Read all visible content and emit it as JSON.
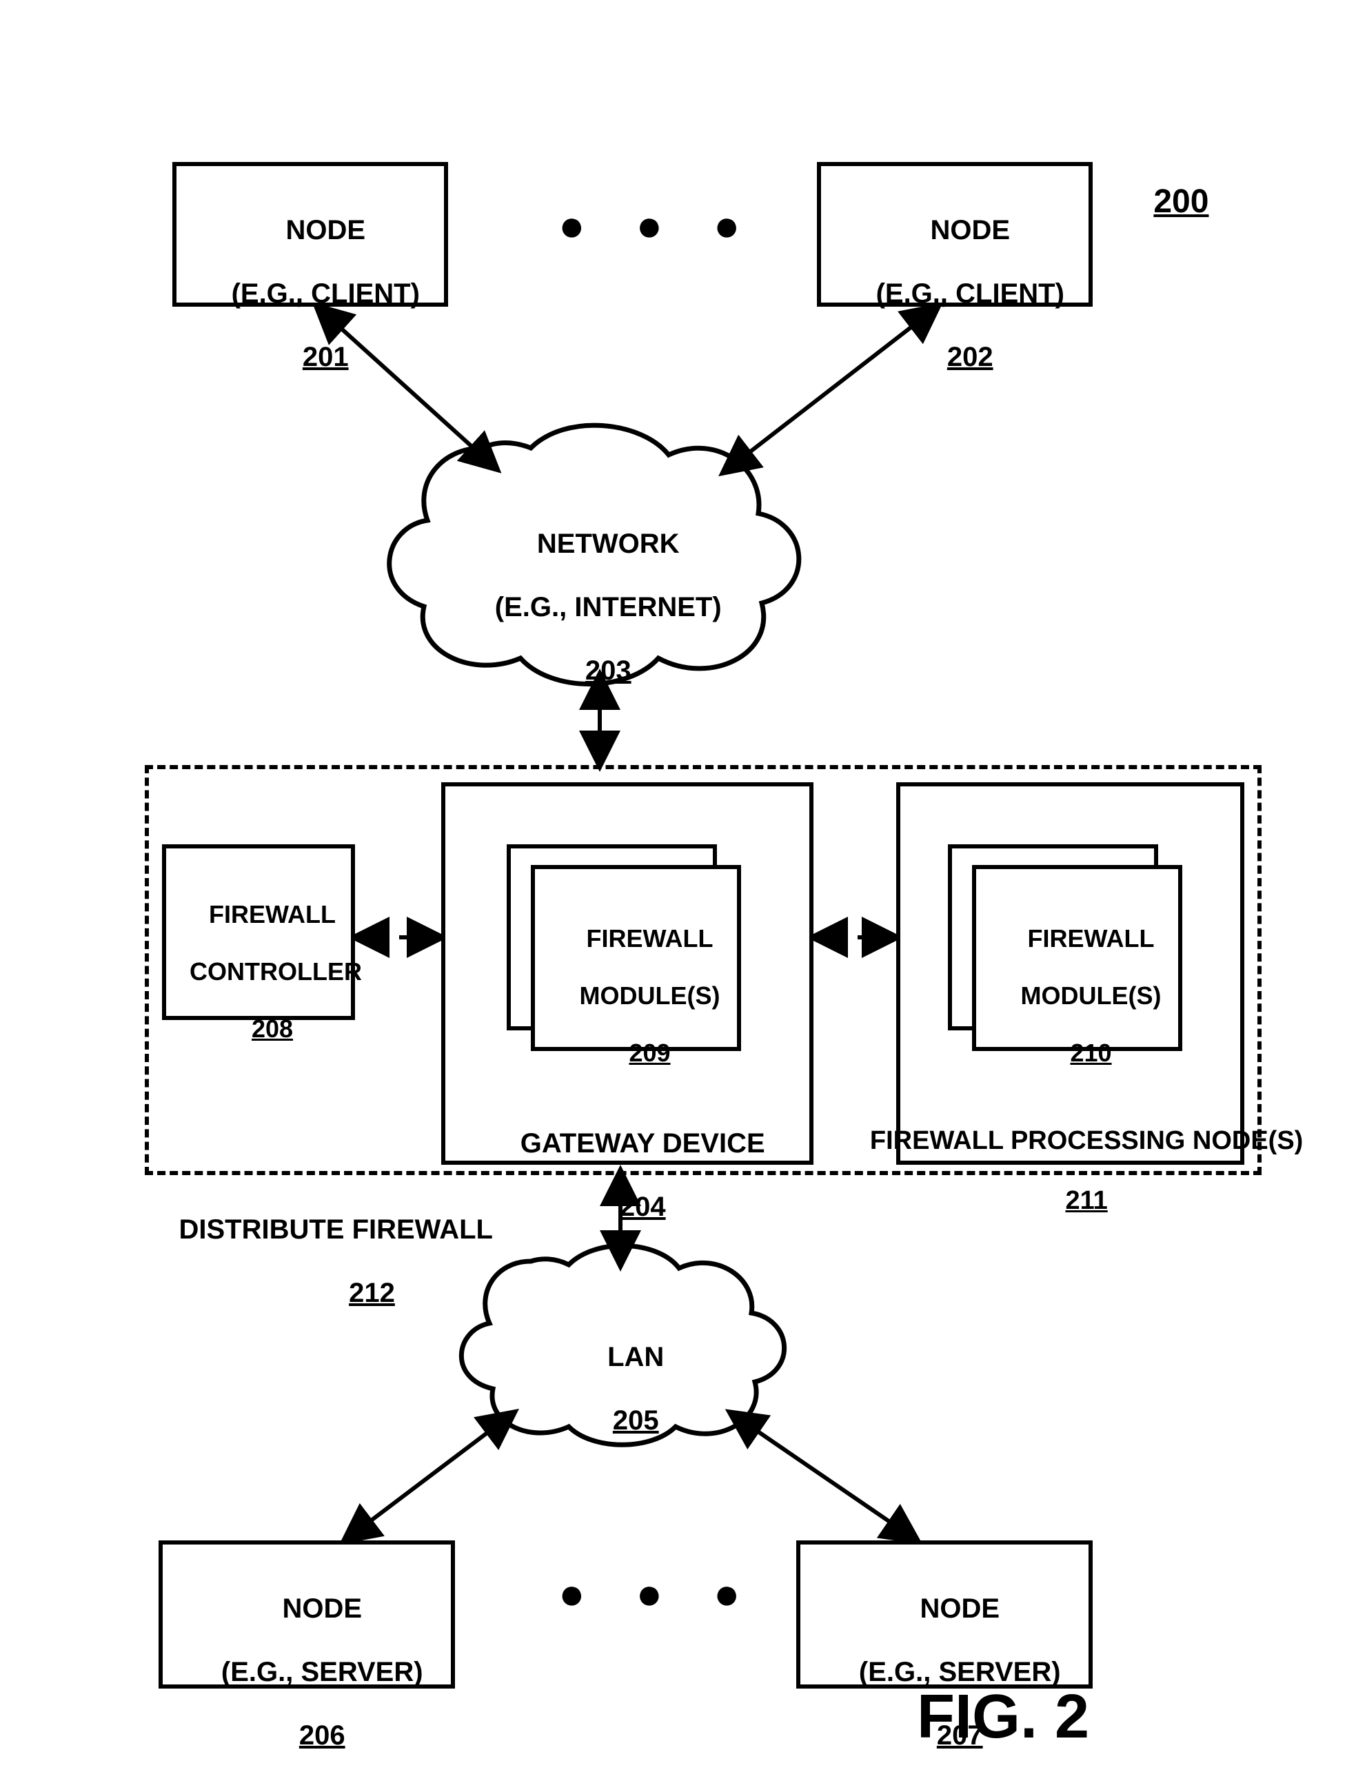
{
  "figure_id": "200",
  "figure_label": "FIG. 2",
  "nodes": {
    "client1": {
      "title": "NODE",
      "subtitle": "(E.G., CLIENT)",
      "ref": "201"
    },
    "client2": {
      "title": "NODE",
      "subtitle": "(E.G., CLIENT)",
      "ref": "202"
    },
    "network": {
      "title": "NETWORK",
      "subtitle": "(E.G., INTERNET)",
      "ref": "203"
    },
    "gateway": {
      "title": "GATEWAY DEVICE",
      "ref": "204"
    },
    "lan": {
      "title": "LAN",
      "ref": "205"
    },
    "server1": {
      "title": "NODE",
      "subtitle": "(E.G., SERVER)",
      "ref": "206"
    },
    "server2": {
      "title": "NODE",
      "subtitle": "(E.G., SERVER)",
      "ref": "207"
    },
    "fw_controller": {
      "title": "FIREWALL",
      "subtitle": "CONTROLLER",
      "ref": "208"
    },
    "fw_module_gw": {
      "title": "FIREWALL",
      "subtitle": "MODULE(S)",
      "ref": "209"
    },
    "fw_module_pn": {
      "title": "FIREWALL",
      "subtitle": "MODULE(S)",
      "ref": "210"
    },
    "fw_proc_nodes": {
      "title": "FIREWALL PROCESSING NODE(S)",
      "ref": "211"
    },
    "dist_fw": {
      "title": "DISTRIBUTE FIREWALL",
      "ref": "212"
    }
  },
  "ellipsis": "● ● ●"
}
